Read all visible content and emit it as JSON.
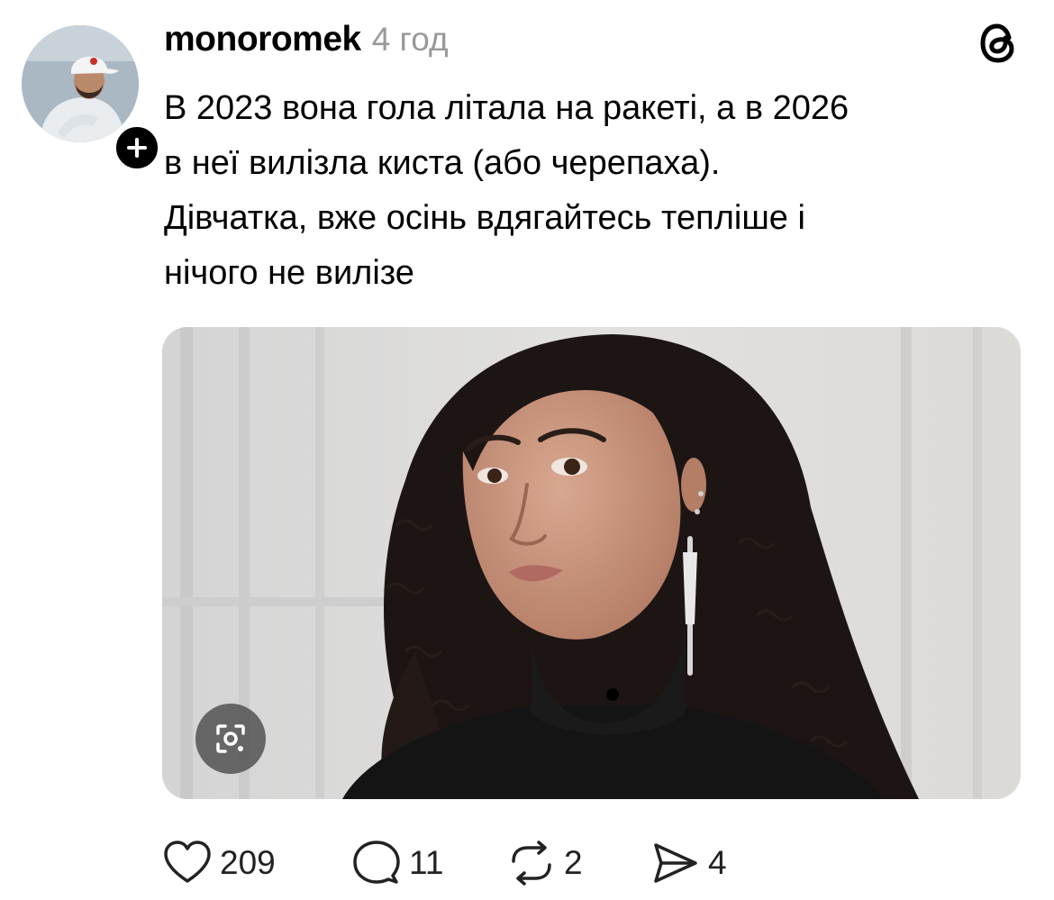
{
  "post": {
    "username": "monoromek",
    "timestamp": "4 год",
    "text_lines": [
      "В 2023 вона гола літала на ракеті, а в 2026",
      "в неї вилізла киста (або черепаха).",
      "Дівчатка, вже осінь вдягайтесь тепліше і",
      "нічого не вилізе"
    ]
  },
  "icons": {
    "avatar": "user-avatar",
    "follow": "plus-icon",
    "brand": "threads-logo-icon",
    "lens": "lens-search-icon",
    "like": "heart-icon",
    "reply": "comment-icon",
    "repost": "repost-icon",
    "share": "send-icon"
  },
  "actions": {
    "likes": "209",
    "replies": "11",
    "reposts": "2",
    "shares": "4"
  },
  "colors": {
    "text": "#000000",
    "muted": "#999999",
    "badge": "#000000"
  }
}
